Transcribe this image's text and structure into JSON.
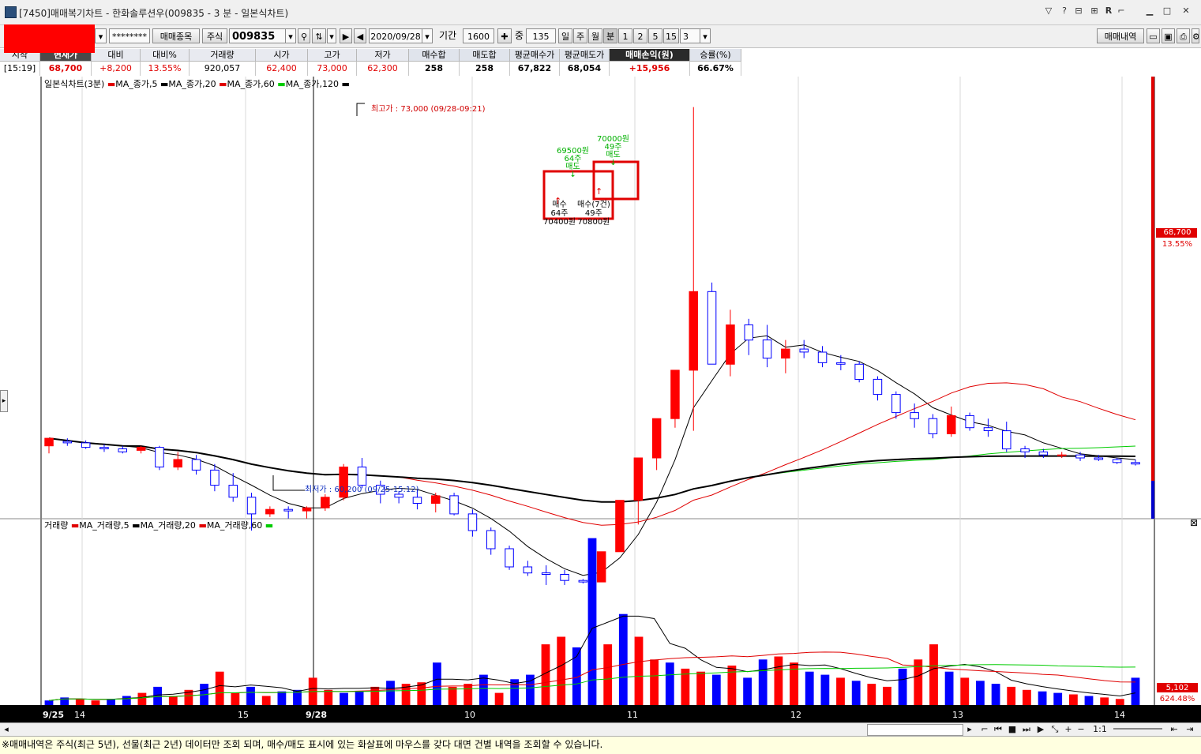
{
  "window": {
    "title": "[7450]매매복기차트 - 한화솔루션우(009835 - 3 분 - 일본식차트)"
  },
  "toolbar": {
    "password_mask": "********",
    "trade_items_button": "매매종목",
    "market_label": "주식",
    "code_value": "009835",
    "date_value": "2020/09/28",
    "period_label": "기간",
    "period_value": "1600",
    "count_label": "중",
    "count_value": "135",
    "day_tab": "일",
    "week_tab": "주",
    "month_tab": "월",
    "minute_tab": "분",
    "interval_1": "1",
    "interval_2": "2",
    "interval_5": "5",
    "interval_15": "15",
    "interval_value": "3",
    "trade_history_button": "매매내역"
  },
  "info": {
    "headers": [
      "시작",
      "현재가",
      "대비",
      "대비%",
      "거래량",
      "시가",
      "고가",
      "저가",
      "매수합",
      "매도합",
      "평균매수가",
      "평균매도가",
      "매매손익(원)",
      "승률(%)"
    ],
    "values": [
      "[15:19]",
      "68,700",
      "+8,200",
      "13.55%",
      "920,057",
      "62,400",
      "73,000",
      "62,300",
      "258",
      "258",
      "67,822",
      "68,054",
      "+15,956",
      "66.67%"
    ]
  },
  "legend_price": {
    "title": "일본식차트(3분)",
    "ma5": "MA_종가,5",
    "ma20": "MA_종가,20",
    "ma60": "MA_종가,60",
    "ma120": "MA_종가,120"
  },
  "legend_volume": {
    "title": "거래량",
    "ma5": "MA_거래량,5",
    "ma20": "MA_거래량,20",
    "ma60": "MA_거래량,60"
  },
  "annotations": {
    "high": "최고가 : 73,000 (09/28-09:21)",
    "low": "최저가 : 60,200 (09/25-15:12)",
    "sell1_price": "69500원",
    "sell1_qty": "64주",
    "sell1_label": "매도",
    "sell2_price": "70000원",
    "sell2_qty": "49주",
    "sell2_label": "매도",
    "buy1_label": "매수",
    "buy1_qty": "64주",
    "buy1_price": "70400원",
    "buy2_label": "매수(7건)",
    "buy2_qty": "49주",
    "buy2_price": "70800원"
  },
  "price_axis": {
    "current": "68,700",
    "change_pct": "13.55%"
  },
  "volume_axis": {
    "current": "5,102",
    "change_pct": "624.48%"
  },
  "time_labels": [
    "9/25",
    "14",
    "15",
    "9/28",
    "10",
    "11",
    "12",
    "13",
    "14"
  ],
  "scroll": {
    "zoom_label": "1:1"
  },
  "status": {
    "message": "※매매내역은 주식(최근 5년), 선물(최근 2년) 데이터만 조회 되며, 매수/매도 표시에 있는 화살표에 마우스를 갖다 대면 건별 내역을 조회할 수 있습니다."
  },
  "colors": {
    "up": "#ff0000",
    "down": "#0000ff",
    "ma5": "#000000",
    "ma20": "#e00000",
    "ma60": "#00cc00",
    "ma120": "#000000"
  },
  "chart_data": {
    "type": "candlestick",
    "title": "일본식차트(3분)",
    "ylim": [
      59600,
      73800
    ],
    "candles": [
      {
        "o": 61800,
        "h": 62050,
        "l": 61550,
        "c": 62050,
        "d": "09/25"
      },
      {
        "o": 61950,
        "h": 62050,
        "l": 61800,
        "c": 61900
      },
      {
        "o": 61900,
        "h": 61980,
        "l": 61700,
        "c": 61750
      },
      {
        "o": 61750,
        "h": 61850,
        "l": 61600,
        "c": 61700
      },
      {
        "o": 61700,
        "h": 61800,
        "l": 61550,
        "c": 61600
      },
      {
        "o": 61650,
        "h": 61800,
        "l": 61550,
        "c": 61750
      },
      {
        "o": 61750,
        "h": 61800,
        "l": 61000,
        "c": 61100
      },
      {
        "o": 61100,
        "h": 61600,
        "l": 61000,
        "c": 61350
      },
      {
        "o": 61350,
        "h": 61500,
        "l": 60850,
        "c": 61000
      },
      {
        "o": 61000,
        "h": 61200,
        "l": 60300,
        "c": 60500
      },
      {
        "o": 60500,
        "h": 60900,
        "l": 59950,
        "c": 60100
      },
      {
        "o": 60100,
        "h": 60250,
        "l": 59000,
        "c": 59550
      },
      {
        "o": 59550,
        "h": 59800,
        "l": 59450,
        "c": 59700
      },
      {
        "o": 59700,
        "h": 59800,
        "l": 59400,
        "c": 59650
      },
      {
        "o": 59650,
        "h": 59800,
        "l": 59400,
        "c": 59750
      },
      {
        "o": 59750,
        "h": 60200,
        "l": 59650,
        "c": 60100
      },
      {
        "o": 60100,
        "h": 61200,
        "l": 60000,
        "c": 61100
      },
      {
        "o": 61100,
        "h": 61400,
        "l": 60400,
        "c": 60500
      },
      {
        "o": 60500,
        "h": 60650,
        "l": 59900,
        "c": 60200
      },
      {
        "o": 60200,
        "h": 60300,
        "l": 59900,
        "c": 60100
      },
      {
        "o": 60100,
        "h": 60350,
        "l": 59700,
        "c": 59900
      },
      {
        "o": 59900,
        "h": 60250,
        "l": 59600,
        "c": 60150
      },
      {
        "o": 60150,
        "h": 60250,
        "l": 59500,
        "c": 59550
      },
      {
        "o": 59550,
        "h": 59700,
        "l": 58800,
        "c": 59000
      },
      {
        "o": 59000,
        "h": 59100,
        "l": 58200,
        "c": 58400
      },
      {
        "o": 58400,
        "h": 58500,
        "l": 57700,
        "c": 57800
      },
      {
        "o": 57800,
        "h": 58000,
        "l": 57500,
        "c": 57600
      },
      {
        "o": 57600,
        "h": 57850,
        "l": 57200,
        "c": 57550
      },
      {
        "o": 57550,
        "h": 57700,
        "l": 57200,
        "c": 57350
      },
      {
        "o": 57350,
        "h": 57400,
        "l": 57250,
        "c": 57300,
        "d": "09/25"
      },
      {
        "o": 57300,
        "h": 58300,
        "l": 57300,
        "c": 58300,
        "d": "09/28"
      },
      {
        "o": 58300,
        "h": 60000,
        "l": 58300,
        "c": 60000
      },
      {
        "o": 60000,
        "h": 61400,
        "l": 59200,
        "c": 61400
      },
      {
        "o": 61400,
        "h": 62700,
        "l": 61000,
        "c": 62700
      },
      {
        "o": 62700,
        "h": 64300,
        "l": 62400,
        "c": 64300
      },
      {
        "o": 64300,
        "h": 73000,
        "l": 62300,
        "c": 66900
      },
      {
        "o": 66900,
        "h": 67200,
        "l": 64500,
        "c": 64500
      },
      {
        "o": 64500,
        "h": 66300,
        "l": 64100,
        "c": 65800
      },
      {
        "o": 65800,
        "h": 66000,
        "l": 64800,
        "c": 65300
      },
      {
        "o": 65300,
        "h": 65800,
        "l": 64400,
        "c": 64700
      },
      {
        "o": 64700,
        "h": 65300,
        "l": 64200,
        "c": 65000
      },
      {
        "o": 65000,
        "h": 65300,
        "l": 64700,
        "c": 64900
      },
      {
        "o": 64900,
        "h": 65100,
        "l": 64400,
        "c": 64550
      },
      {
        "o": 64550,
        "h": 64800,
        "l": 64300,
        "c": 64500
      },
      {
        "o": 64500,
        "h": 64600,
        "l": 63900,
        "c": 64000
      },
      {
        "o": 64000,
        "h": 64100,
        "l": 63300,
        "c": 63500
      },
      {
        "o": 63500,
        "h": 63600,
        "l": 62700,
        "c": 62900
      },
      {
        "o": 62900,
        "h": 63200,
        "l": 62400,
        "c": 62700
      },
      {
        "o": 62700,
        "h": 62850,
        "l": 62050,
        "c": 62200
      },
      {
        "o": 62200,
        "h": 63100,
        "l": 62100,
        "c": 62800
      },
      {
        "o": 62800,
        "h": 62900,
        "l": 62300,
        "c": 62400
      },
      {
        "o": 62400,
        "h": 62700,
        "l": 62100,
        "c": 62300
      },
      {
        "o": 62300,
        "h": 62600,
        "l": 61600,
        "c": 61700
      },
      {
        "o": 61700,
        "h": 61800,
        "l": 61400,
        "c": 61600
      },
      {
        "o": 61600,
        "h": 61700,
        "l": 61400,
        "c": 61500
      },
      {
        "o": 61500,
        "h": 61600,
        "l": 61400,
        "c": 61500
      },
      {
        "o": 61500,
        "h": 61600,
        "l": 61300,
        "c": 61400
      },
      {
        "o": 61400,
        "h": 61500,
        "l": 61300,
        "c": 61350
      },
      {
        "o": 61350,
        "h": 61400,
        "l": 61200,
        "c": 61250
      },
      {
        "o": 61250,
        "h": 61350,
        "l": 61150,
        "c": 61200,
        "d": "09/28"
      }
    ],
    "series": [
      {
        "name": "MA_종가,5"
      },
      {
        "name": "MA_종가,20"
      },
      {
        "name": "MA_종가,60"
      },
      {
        "name": "MA_종가,120"
      }
    ]
  },
  "volume_data": {
    "type": "bar",
    "title": "거래량",
    "values": [
      3,
      5,
      4,
      3,
      4,
      6,
      8,
      12,
      6,
      10,
      14,
      22,
      8,
      12,
      6,
      9,
      10,
      18,
      10,
      8,
      9,
      12,
      16,
      14,
      15,
      28,
      12,
      14,
      20,
      8,
      17,
      20,
      40,
      45,
      38,
      110,
      40,
      60,
      45,
      30,
      28,
      24,
      22,
      20,
      26,
      18,
      30,
      32,
      28,
      22,
      20,
      18,
      16,
      14,
      12,
      24,
      30,
      40,
      22,
      18,
      16,
      14,
      12,
      10,
      9,
      8,
      7,
      6,
      5,
      4,
      18
    ],
    "series": [
      {
        "name": "MA_거래량,5"
      },
      {
        "name": "MA_거래량,20"
      },
      {
        "name": "MA_거래량,60"
      }
    ]
  }
}
